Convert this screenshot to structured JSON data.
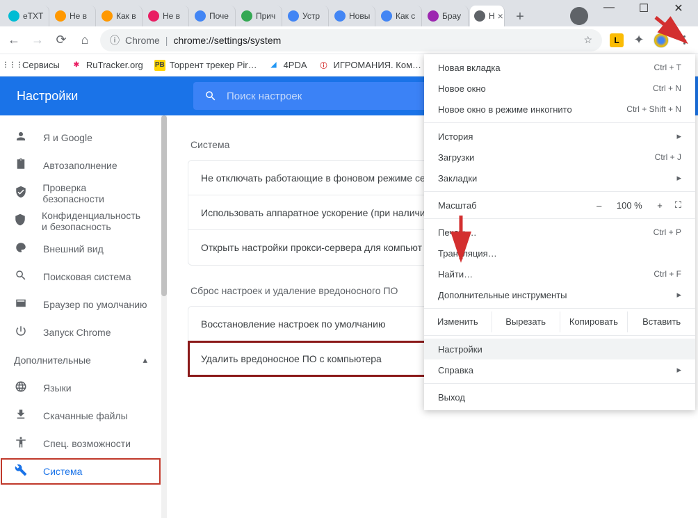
{
  "window": {
    "min": "—",
    "max": "☐",
    "close": "✕"
  },
  "tabs": [
    {
      "label": "eTXT",
      "color": "#00bcd4"
    },
    {
      "label": "Не в",
      "color": "#ff9800"
    },
    {
      "label": "Как в",
      "color": "#ff9800"
    },
    {
      "label": "Не в",
      "color": "#e91e63"
    },
    {
      "label": "Поче",
      "color": "#4285f4"
    },
    {
      "label": "Прич",
      "color": "#34a853"
    },
    {
      "label": "Устр",
      "color": "#4285f4"
    },
    {
      "label": "Новы",
      "color": "#4285f4"
    },
    {
      "label": "Как с",
      "color": "#4285f4"
    },
    {
      "label": "Брау",
      "color": "#9c27b0"
    },
    {
      "label": "Н",
      "color": "#5f6368",
      "active": true
    }
  ],
  "addr": {
    "chrome_label": "Chrome",
    "url": "chrome://settings/system",
    "star": "☆"
  },
  "bookmarks": [
    {
      "label": "Сервисы",
      "icon": "⋮⋮⋮",
      "bg": "#fff"
    },
    {
      "label": "RuTracker.org",
      "icon": "✱",
      "bg": "#fff",
      "color": "#e91e63"
    },
    {
      "label": "Торрент трекер Pir…",
      "icon": "PB",
      "bg": "#ffd600"
    },
    {
      "label": "4PDA",
      "icon": "◢",
      "bg": "#fff",
      "color": "#2196f3"
    },
    {
      "label": "ИГРОМАНИЯ. Ком…",
      "icon": "ⓘ",
      "bg": "#fff",
      "color": "#d32f2f"
    }
  ],
  "settings": {
    "title": "Настройки",
    "search_placeholder": "Поиск настроек"
  },
  "nav": {
    "items": [
      {
        "icon": "person",
        "label": "Я и Google"
      },
      {
        "icon": "clipboard",
        "label": "Автозаполнение"
      },
      {
        "icon": "shield-check",
        "label": "Проверка безопасности"
      },
      {
        "icon": "shield",
        "label": "Конфиденциальность и безопасность"
      },
      {
        "icon": "palette",
        "label": "Внешний вид"
      },
      {
        "icon": "search",
        "label": "Поисковая система"
      },
      {
        "icon": "browser",
        "label": "Браузер по умолчанию"
      },
      {
        "icon": "power",
        "label": "Запуск Chrome"
      }
    ],
    "advanced": "Дополнительные",
    "adv_items": [
      {
        "icon": "globe",
        "label": "Языки"
      },
      {
        "icon": "download",
        "label": "Скачанные файлы"
      },
      {
        "icon": "accessibility",
        "label": "Спец. возможности"
      },
      {
        "icon": "wrench",
        "label": "Система",
        "active": true
      }
    ]
  },
  "sections": {
    "system": {
      "title": "Система",
      "rows": [
        "Не отключать работающие в фоновом режиме се",
        "Использовать аппаратное ускорение (при наличи",
        "Открыть настройки прокси-сервера для компьют"
      ]
    },
    "reset": {
      "title": "Сброс настроек и удаление вредоносного ПО",
      "rows": [
        "Восстановление настроек по умолчанию",
        "Удалить вредоносное ПО с компьютера"
      ]
    }
  },
  "menu": {
    "new_tab": "Новая вкладка",
    "new_tab_sc": "Ctrl + T",
    "new_window": "Новое окно",
    "new_window_sc": "Ctrl + N",
    "incognito": "Новое окно в режиме инкогнито",
    "incognito_sc": "Ctrl + Shift + N",
    "history": "История",
    "downloads": "Загрузки",
    "downloads_sc": "Ctrl + J",
    "bookmarks": "Закладки",
    "zoom": "Масштаб",
    "zoom_val": "100 %",
    "zoom_minus": "–",
    "zoom_plus": "+",
    "fullscreen": "⛶",
    "print": "Печать…",
    "print_sc": "Ctrl + P",
    "cast": "Трансляция…",
    "find": "Найти…",
    "find_sc": "Ctrl + F",
    "more_tools": "Дополнительные инструменты",
    "edit": "Изменить",
    "cut": "Вырезать",
    "copy": "Копировать",
    "paste": "Вставить",
    "settings": "Настройки",
    "help": "Справка",
    "exit": "Выход"
  }
}
